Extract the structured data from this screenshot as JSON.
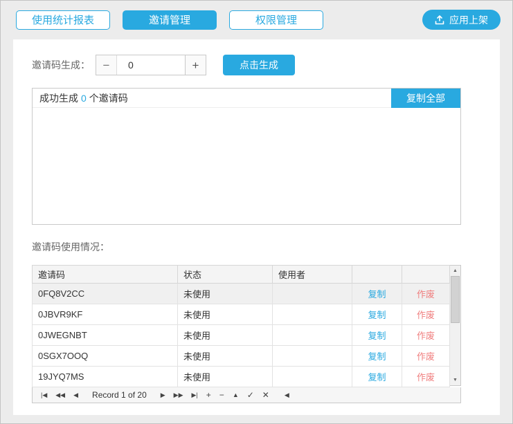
{
  "colors": {
    "accent": "#29a9e0",
    "danger": "#f07e7e",
    "background": "#ececec"
  },
  "tabs": [
    {
      "label": "使用统计报表",
      "active": false
    },
    {
      "label": "邀请管理",
      "active": true
    },
    {
      "label": "权限管理",
      "active": false
    }
  ],
  "publish": {
    "label": "应用上架"
  },
  "generator": {
    "label": "邀请码生成：",
    "minus": "−",
    "value": "0",
    "plus": "+",
    "generate_label": "点击生成"
  },
  "result": {
    "prefix": "成功生成",
    "count": "0",
    "suffix": "个邀请码",
    "copy_all_label": "复制全部"
  },
  "usage": {
    "label": "邀请码使用情况：",
    "headers": [
      "邀请码",
      "状态",
      "使用者",
      "",
      ""
    ],
    "rows": [
      {
        "code": "0FQ8V2CC",
        "status": "未使用",
        "user": "",
        "copy": "复制",
        "void": "作废"
      },
      {
        "code": "0JBVR9KF",
        "status": "未使用",
        "user": "",
        "copy": "复制",
        "void": "作废"
      },
      {
        "code": "0JWEGNBT",
        "status": "未使用",
        "user": "",
        "copy": "复制",
        "void": "作废"
      },
      {
        "code": "0SGX7OOQ",
        "status": "未使用",
        "user": "",
        "copy": "复制",
        "void": "作废"
      },
      {
        "code": "19JYQ7MS",
        "status": "未使用",
        "user": "",
        "copy": "复制",
        "void": "作废"
      }
    ],
    "navigator": {
      "record_text": "Record 1 of 20",
      "first": "|◀",
      "prev_page": "◀◀",
      "prev": "◀",
      "next": "▶",
      "next_page": "▶▶",
      "last": "▶|",
      "append": "+",
      "delete": "−",
      "edit": "▲",
      "post": "✓",
      "cancel": "✕",
      "refresh": "◀"
    },
    "scrollbar": {
      "up": "▲",
      "down": "▼"
    }
  }
}
